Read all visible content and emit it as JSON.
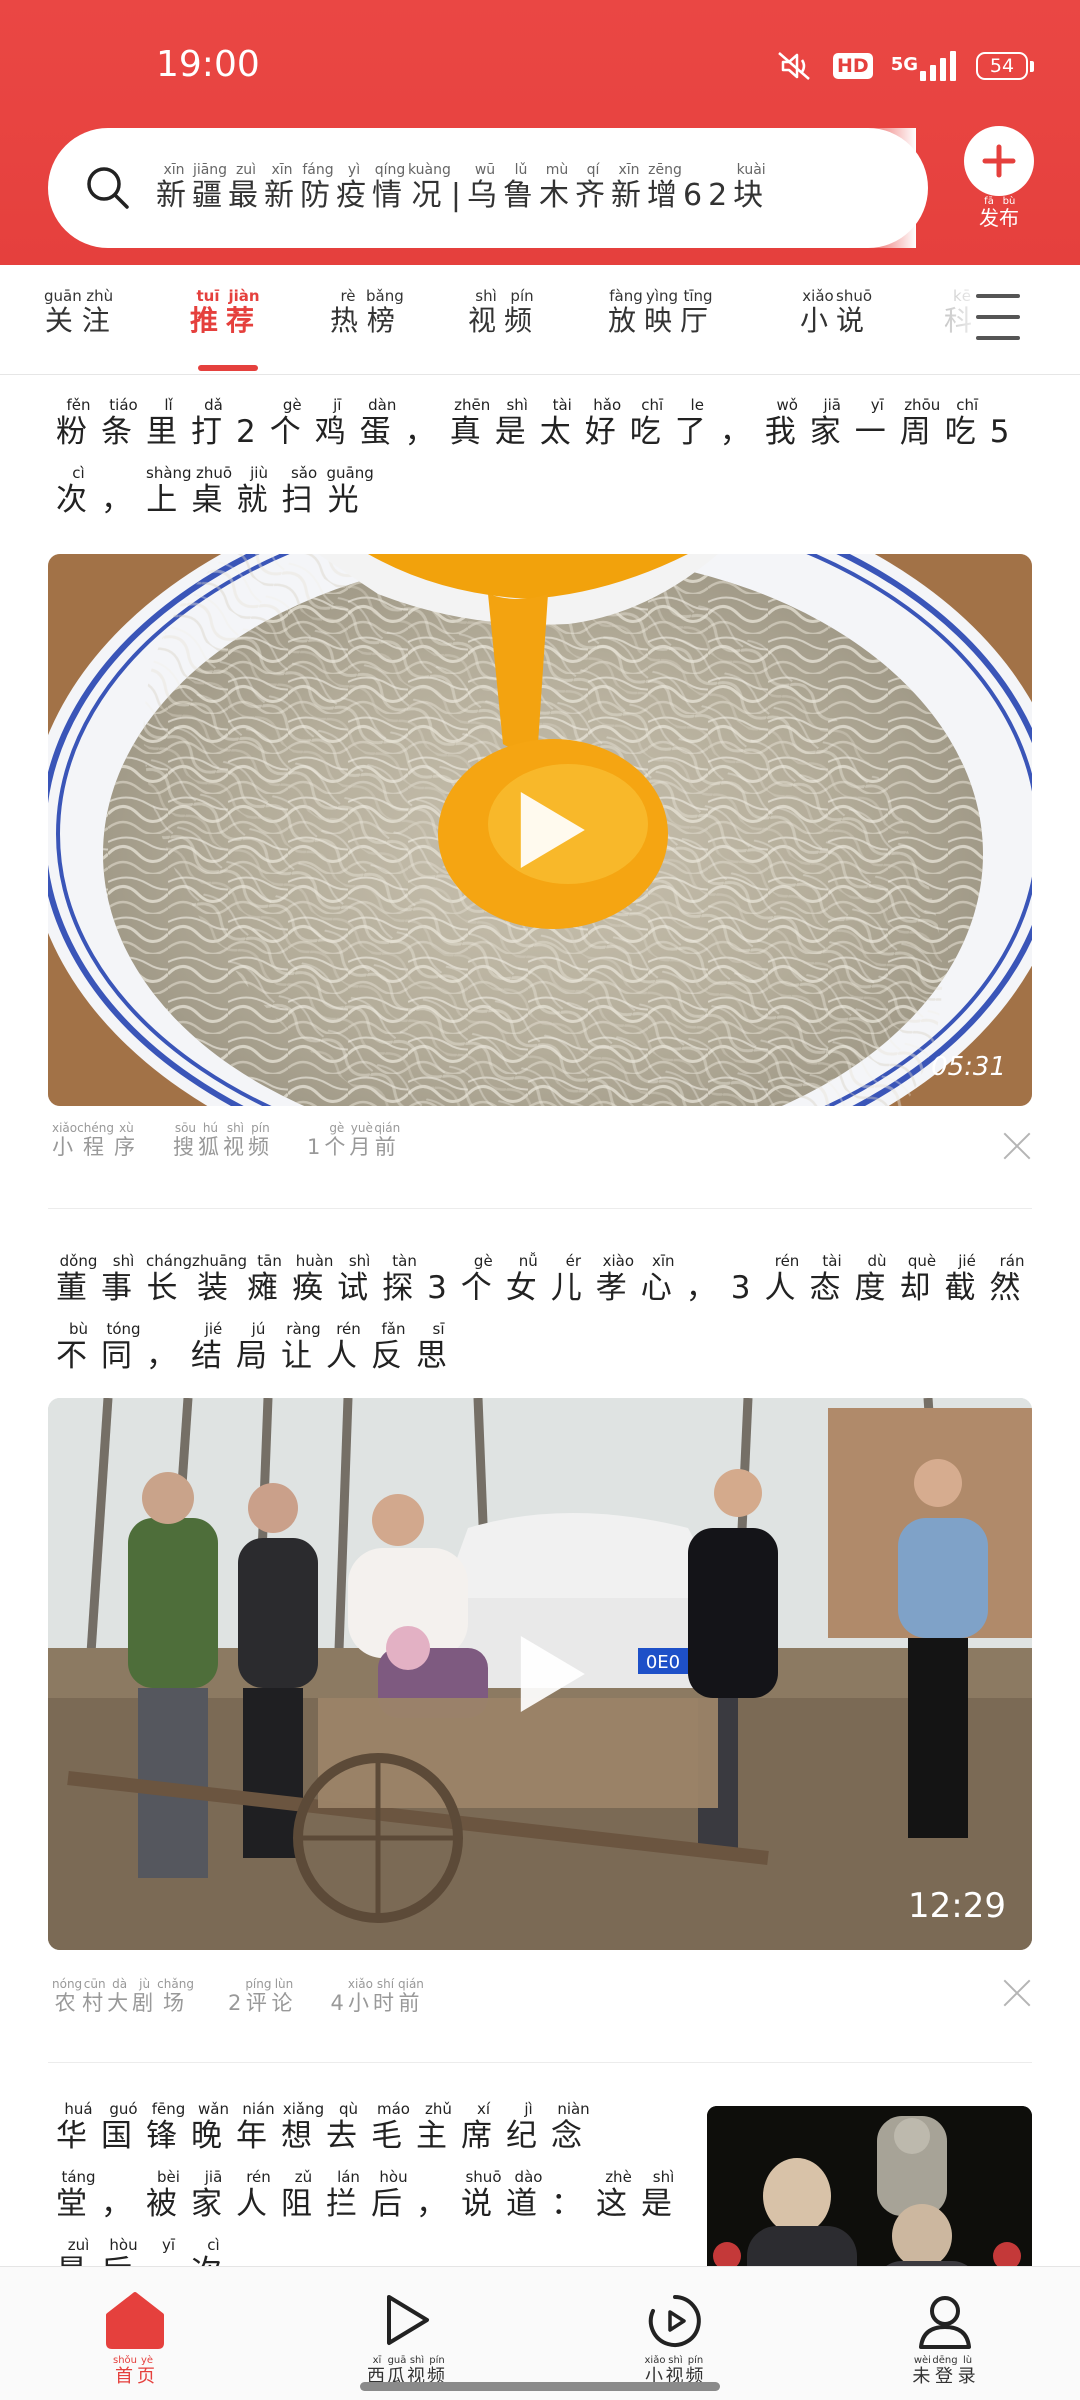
{
  "status_bar": {
    "time": "19:00",
    "hd": "HD",
    "network": "5G",
    "battery": "54"
  },
  "search": {
    "chars": [
      "新",
      "疆",
      "最",
      "新",
      "防",
      "疫",
      "情",
      "况",
      "|",
      "乌",
      "鲁",
      "木",
      "齐",
      "新",
      "增",
      "62",
      "块"
    ],
    "pinyin": [
      "xīn",
      "jiāng",
      "zuì",
      "xīn",
      "fáng",
      "yì",
      "qíng",
      "kuàng",
      "",
      "wū",
      "lǔ",
      "mù",
      "qí",
      "xīn",
      "zēng",
      "",
      "kuài"
    ]
  },
  "publish": {
    "chars": [
      "发",
      "布"
    ],
    "pinyin": [
      "fā",
      "bù"
    ]
  },
  "tabs": [
    {
      "chars": [
        "关",
        "注"
      ],
      "pinyin": [
        "guān",
        "zhù"
      ]
    },
    {
      "chars": [
        "推",
        "荐"
      ],
      "pinyin": [
        "tuī",
        "jiàn"
      ]
    },
    {
      "chars": [
        "热",
        "榜"
      ],
      "pinyin": [
        "rè",
        "bǎng"
      ]
    },
    {
      "chars": [
        "视",
        "频"
      ],
      "pinyin": [
        "shì",
        "pín"
      ]
    },
    {
      "chars": [
        "放",
        "映",
        "厅"
      ],
      "pinyin": [
        "fàng",
        "yìng",
        "tīng"
      ]
    },
    {
      "chars": [
        "小",
        "说"
      ],
      "pinyin": [
        "xiǎo",
        "shuō"
      ]
    },
    {
      "chars": [
        "科"
      ],
      "pinyin": [
        "kē"
      ]
    }
  ],
  "active_tab": 1,
  "feed": [
    {
      "title_lines": [
        {
          "chars": [
            "粉",
            "条",
            "里",
            "打",
            "2",
            "个",
            "鸡",
            "蛋",
            "，",
            "真",
            "是",
            "太",
            "好",
            "吃",
            "了",
            "，",
            "我",
            "家",
            "一",
            "周",
            "吃",
            "5"
          ],
          "pinyin": [
            "fěn",
            "tiáo",
            "lǐ",
            "dǎ",
            "",
            "gè",
            "jī",
            "dàn",
            "",
            "zhēn",
            "shì",
            "tài",
            "hǎo",
            "chī",
            "le",
            "",
            "wǒ",
            "jiā",
            "yī",
            "zhōu",
            "chī",
            ""
          ]
        },
        {
          "chars": [
            "次",
            "，",
            "上",
            "桌",
            "就",
            "扫",
            "光"
          ],
          "pinyin": [
            "cì",
            "",
            "shàng",
            "zhuō",
            "jiù",
            "sǎo",
            "guāng"
          ]
        }
      ],
      "duration": "05:31",
      "meta": [
        {
          "chars": [
            "小",
            "程",
            "序"
          ],
          "pinyin": [
            "xiǎo",
            "chéng",
            "xù"
          ]
        },
        {
          "chars": [
            "搜",
            "狐",
            "视",
            "频"
          ],
          "pinyin": [
            "sōu",
            "hú",
            "shì",
            "pín"
          ]
        },
        {
          "chars": [
            "1",
            "个",
            "月",
            "前"
          ],
          "pinyin": [
            "",
            "gè",
            "yuè",
            "qián"
          ]
        }
      ]
    },
    {
      "title_lines": [
        {
          "chars": [
            "董",
            "事",
            "长",
            "装",
            "瘫",
            "痪",
            "试",
            "探",
            "3",
            "个",
            "女",
            "儿",
            "孝",
            "心",
            "，",
            "3",
            "人",
            "态",
            "度",
            "却",
            "截",
            "然"
          ],
          "pinyin": [
            "dǒng",
            "shì",
            "cháng",
            "zhuāng",
            "tān",
            "huàn",
            "shì",
            "tàn",
            "",
            "gè",
            "nǚ",
            "ér",
            "xiào",
            "xīn",
            "",
            "",
            "rén",
            "tài",
            "dù",
            "què",
            "jié",
            "rán"
          ]
        },
        {
          "chars": [
            "不",
            "同",
            "，",
            "结",
            "局",
            "让",
            "人",
            "反",
            "思"
          ],
          "pinyin": [
            "bù",
            "tóng",
            "",
            "jié",
            "jú",
            "ràng",
            "rén",
            "fǎn",
            "sī"
          ]
        }
      ],
      "duration": "12:29",
      "car_plate": "0E0",
      "meta": [
        {
          "chars": [
            "农",
            "村",
            "大",
            "剧",
            "场"
          ],
          "pinyin": [
            "nóng",
            "cūn",
            "dà",
            "jù",
            "chǎng"
          ]
        },
        {
          "chars": [
            "2",
            "评",
            "论"
          ],
          "pinyin": [
            "",
            "píng",
            "lùn"
          ]
        },
        {
          "chars": [
            "4",
            "小",
            "时",
            "前"
          ],
          "pinyin": [
            "",
            "xiǎo",
            "shí",
            "qián"
          ]
        }
      ]
    },
    {
      "title_lines": [
        {
          "chars": [
            "华",
            "国",
            "锋",
            "晚",
            "年",
            "想",
            "去",
            "毛",
            "主",
            "席",
            "纪",
            "念"
          ],
          "pinyin": [
            "huá",
            "guó",
            "fēng",
            "wǎn",
            "nián",
            "xiǎng",
            "qù",
            "máo",
            "zhǔ",
            "xí",
            "jì",
            "niàn"
          ]
        },
        {
          "chars": [
            "堂",
            "，",
            "被",
            "家",
            "人",
            "阻",
            "拦",
            "后",
            "，",
            "说",
            "道",
            "：",
            "这",
            "是"
          ],
          "pinyin": [
            "táng",
            "",
            "bèi",
            "jiā",
            "rén",
            "zǔ",
            "lán",
            "hòu",
            "",
            "shuō",
            "dào",
            "",
            "zhè",
            "shì"
          ]
        },
        {
          "chars": [
            "最",
            "后",
            "一",
            "次"
          ],
          "pinyin": [
            "zuì",
            "hòu",
            "yī",
            "cì"
          ]
        }
      ]
    }
  ],
  "bottom_nav": [
    {
      "chars": [
        "首",
        "页"
      ],
      "pinyin": [
        "shǒu",
        "yè"
      ],
      "icon": "home-icon"
    },
    {
      "chars": [
        "西",
        "瓜",
        "视",
        "频"
      ],
      "pinyin": [
        "xī",
        "guā",
        "shì",
        "pín"
      ],
      "icon": "play-icon"
    },
    {
      "chars": [
        "小",
        "视",
        "频"
      ],
      "pinyin": [
        "xiǎo",
        "shì",
        "pín"
      ],
      "icon": "short-video-icon"
    },
    {
      "chars": [
        "未",
        "登",
        "录"
      ],
      "pinyin": [
        "wèi",
        "dēng",
        "lù"
      ],
      "icon": "user-icon"
    }
  ],
  "colors": {
    "brand_red": "#e5403d",
    "text": "#222222",
    "meta_gray": "#999999"
  }
}
